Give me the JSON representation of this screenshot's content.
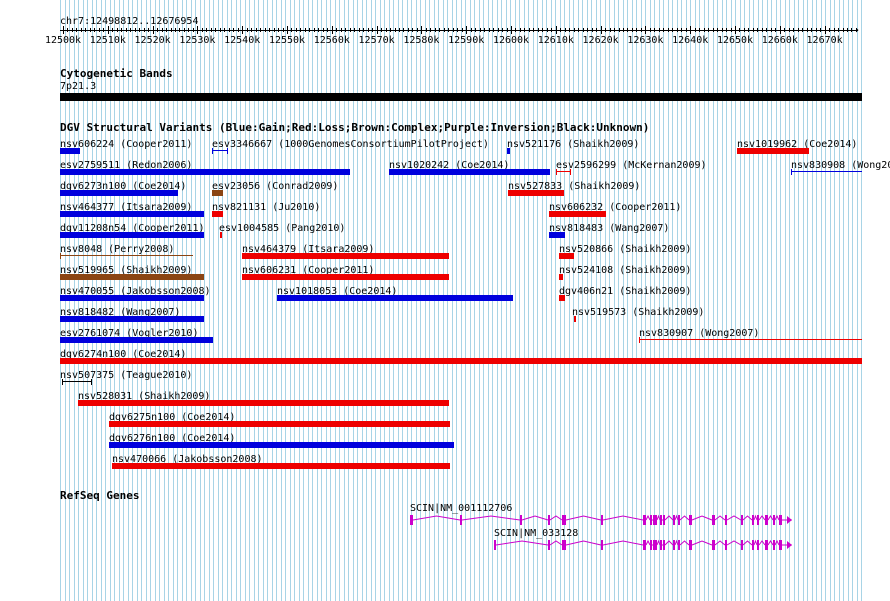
{
  "location": "chr7:12498812..12676954",
  "ruler": {
    "labels": [
      "12500k",
      "12510k",
      "12520k",
      "12530k",
      "12540k",
      "12550k",
      "12560k",
      "12570k",
      "12580k",
      "12590k",
      "12600k",
      "12610k",
      "12620k",
      "12630k",
      "12640k",
      "12650k",
      "12660k",
      "12670k"
    ],
    "start_kb": 12498.812,
    "end_kb": 12676.954
  },
  "tracks": {
    "cytobands": {
      "title": "Cytogenetic Bands",
      "band": "7p21.3"
    },
    "dgv": {
      "title": "DGV Structural Variants (Blue:Gain;Red:Loss;Brown:Complex;Purple:Inversion;Black:Unknown)"
    },
    "refseq": {
      "title": "RefSeq Genes"
    }
  },
  "colors": {
    "gain": "#0000dd",
    "loss": "#ee0000",
    "complex": "#8b4513",
    "unknown": "#000000",
    "gene": "#cc00cc",
    "grid": "#a8d4e6"
  },
  "variants": [
    {
      "name": "nsv606224",
      "src": "(Cooper2011)",
      "type": "gain"
    },
    {
      "name": "esv3346667",
      "src": "(1000GenomesConsortiumPilotProject)",
      "type": "gain"
    },
    {
      "name": "nsv521176",
      "src": "(Shaikh2009)",
      "type": "gain"
    },
    {
      "name": "nsv1019962",
      "src": "(Coe2014)",
      "type": "loss"
    },
    {
      "name": "esv2759511",
      "src": "(Redon2006)",
      "type": "gain"
    },
    {
      "name": "nsv1020242",
      "src": "(Coe2014)",
      "type": "gain"
    },
    {
      "name": "esv2596299",
      "src": "(McKernan2009)",
      "type": "loss"
    },
    {
      "name": "nsv830908",
      "src": "(Wong20",
      "type": "gain"
    },
    {
      "name": "dgv6273n100",
      "src": "(Coe2014)",
      "type": "gain"
    },
    {
      "name": "esv23056",
      "src": "(Conrad2009)",
      "type": "complex"
    },
    {
      "name": "nsv527833",
      "src": "(Shaikh2009)",
      "type": "loss"
    },
    {
      "name": "nsv464377",
      "src": "(Itsara2009)",
      "type": "gain"
    },
    {
      "name": "nsv821131",
      "src": "(Ju2010)",
      "type": "loss"
    },
    {
      "name": "nsv606232",
      "src": "(Cooper2011)",
      "type": "loss"
    },
    {
      "name": "dgv11208n54",
      "src": "(Cooper2011)",
      "type": "gain"
    },
    {
      "name": "esv1004585",
      "src": "(Pang2010)",
      "type": "loss"
    },
    {
      "name": "nsv818483",
      "src": "(Wang2007)",
      "type": "gain"
    },
    {
      "name": "nsv8048",
      "src": "(Perry2008)",
      "type": "complex"
    },
    {
      "name": "nsv464379",
      "src": "(Itsara2009)",
      "type": "loss"
    },
    {
      "name": "nsv520866",
      "src": "(Shaikh2009)",
      "type": "loss"
    },
    {
      "name": "nsv519965",
      "src": "(Shaikh2009)",
      "type": "complex"
    },
    {
      "name": "nsv606231",
      "src": "(Cooper2011)",
      "type": "loss"
    },
    {
      "name": "nsv524108",
      "src": "(Shaikh2009)",
      "type": "loss"
    },
    {
      "name": "nsv470055",
      "src": "(Jakobsson2008)",
      "type": "gain"
    },
    {
      "name": "nsv1018053",
      "src": "(Coe2014)",
      "type": "gain"
    },
    {
      "name": "dgv406n21",
      "src": "(Shaikh2009)",
      "type": "loss"
    },
    {
      "name": "nsv818482",
      "src": "(Wang2007)",
      "type": "gain"
    },
    {
      "name": "nsv519573",
      "src": "(Shaikh2009)",
      "type": "loss"
    },
    {
      "name": "esv2761074",
      "src": "(Vogler2010)",
      "type": "gain"
    },
    {
      "name": "nsv830907",
      "src": "(Wong2007)",
      "type": "loss"
    },
    {
      "name": "dgv6274n100",
      "src": "(Coe2014)",
      "type": "loss"
    },
    {
      "name": "nsv507375",
      "src": "(Teague2010)",
      "type": "unknown"
    },
    {
      "name": "nsv528031",
      "src": "(Shaikh2009)",
      "type": "loss"
    },
    {
      "name": "dgv6275n100",
      "src": "(Coe2014)",
      "type": "loss"
    },
    {
      "name": "dgv6276n100",
      "src": "(Coe2014)",
      "type": "gain"
    },
    {
      "name": "nsv470066",
      "src": "(Jakobsson2008)",
      "type": "loss"
    }
  ],
  "genes": [
    {
      "label": "SCIN|NM_001112706"
    },
    {
      "label": "SCIN|NM_033128"
    }
  ]
}
